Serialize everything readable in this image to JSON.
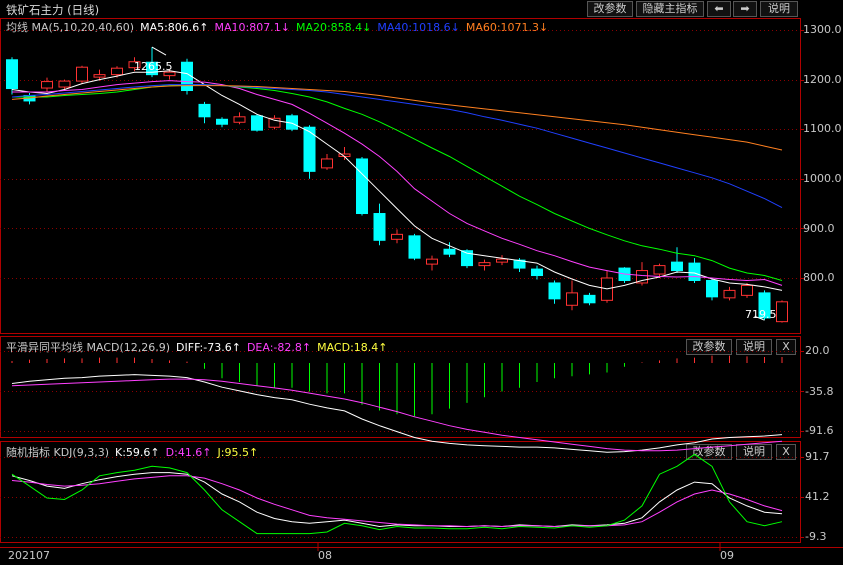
{
  "window": {
    "title": "铁矿石主力 (日线)",
    "buttons": {
      "modify": "改参数",
      "hide": "隐藏主指标",
      "left": "⬅",
      "right": "➡",
      "help": "说明"
    }
  },
  "colors": {
    "up": "#ff3232",
    "down": "#00ffff",
    "ma5": "#ffffff",
    "ma10": "#ff40ff",
    "ma20": "#00ff00",
    "ma40": "#2040ff",
    "ma60": "#ff8020",
    "grid": "#8b0000",
    "axis": "#b00000"
  },
  "main_panel": {
    "legend": {
      "name": "均线 MA(5,10,20,40,60)",
      "ma5": "MA5:806.6↑",
      "ma10": "MA10:807.1↓",
      "ma20": "MA20:858.4↓",
      "ma40": "MA40:1018.6↓",
      "ma60": "MA60:1071.3↓"
    },
    "high_label": "1265.5",
    "low_label": "719.5",
    "y_ticks": [
      "1300.0",
      "1200.0",
      "1100.0",
      "1000.0",
      "900.0",
      "800.0"
    ]
  },
  "macd_panel": {
    "legend": {
      "name": "平滑异同平均线 MACD(12,26,9)",
      "diff": "DIFF:-73.6↑",
      "dea": "DEA:-82.8↑",
      "macd": "MACD:18.4↑"
    },
    "buttons": {
      "modify": "改参数",
      "help": "说明",
      "close": "X"
    },
    "y_ticks": [
      "20.0",
      "-35.8",
      "-91.6"
    ]
  },
  "kdj_panel": {
    "legend": {
      "name": "随机指标 KDJ(9,3,3)",
      "k": "K:59.6↑",
      "d": "D:41.6↑",
      "j": "J:95.5↑"
    },
    "buttons": {
      "modify": "改参数",
      "help": "说明",
      "close": "X"
    },
    "y_ticks": [
      "91.7",
      "41.2",
      "-9.3"
    ]
  },
  "x_axis": {
    "labels": [
      "202107",
      "08",
      "09"
    ]
  },
  "chart_data": [
    {
      "type": "candlestick",
      "title": "铁矿石主力 (日线)",
      "ylim": [
        705,
        1325
      ],
      "candles": [
        {
          "o": 1240,
          "c": 1182,
          "h": 1245,
          "l": 1170
        },
        {
          "o": 1168,
          "c": 1157,
          "h": 1173,
          "l": 1150
        },
        {
          "o": 1183,
          "c": 1196,
          "h": 1204,
          "l": 1176
        },
        {
          "o": 1185,
          "c": 1197,
          "h": 1200,
          "l": 1180
        },
        {
          "o": 1197,
          "c": 1225,
          "h": 1228,
          "l": 1192
        },
        {
          "o": 1205,
          "c": 1210,
          "h": 1220,
          "l": 1198
        },
        {
          "o": 1210,
          "c": 1223,
          "h": 1227,
          "l": 1204
        },
        {
          "o": 1224,
          "c": 1236,
          "h": 1245,
          "l": 1217
        },
        {
          "o": 1235,
          "c": 1210,
          "h": 1265.5,
          "l": 1205
        },
        {
          "o": 1208,
          "c": 1215,
          "h": 1220,
          "l": 1200
        },
        {
          "o": 1235,
          "c": 1178,
          "h": 1242,
          "l": 1170
        },
        {
          "o": 1150,
          "c": 1125,
          "h": 1155,
          "l": 1112
        },
        {
          "o": 1120,
          "c": 1110,
          "h": 1124,
          "l": 1104
        },
        {
          "o": 1114,
          "c": 1125,
          "h": 1134,
          "l": 1110
        },
        {
          "o": 1127,
          "c": 1098,
          "h": 1130,
          "l": 1095
        },
        {
          "o": 1104,
          "c": 1122,
          "h": 1128,
          "l": 1100
        },
        {
          "o": 1127,
          "c": 1100,
          "h": 1131,
          "l": 1096
        },
        {
          "o": 1104,
          "c": 1015,
          "h": 1108,
          "l": 1000
        },
        {
          "o": 1022,
          "c": 1040,
          "h": 1050,
          "l": 1018
        },
        {
          "o": 1045,
          "c": 1050,
          "h": 1064,
          "l": 1038
        },
        {
          "o": 1040,
          "c": 930,
          "h": 1044,
          "l": 926
        },
        {
          "o": 930,
          "c": 876,
          "h": 950,
          "l": 866
        },
        {
          "o": 878,
          "c": 888,
          "h": 898,
          "l": 870
        },
        {
          "o": 885,
          "c": 840,
          "h": 889,
          "l": 836
        },
        {
          "o": 828,
          "c": 838,
          "h": 845,
          "l": 815
        },
        {
          "o": 858,
          "c": 848,
          "h": 872,
          "l": 842
        },
        {
          "o": 855,
          "c": 825,
          "h": 858,
          "l": 820
        },
        {
          "o": 825,
          "c": 831,
          "h": 837,
          "l": 815
        },
        {
          "o": 832,
          "c": 838,
          "h": 846,
          "l": 826
        },
        {
          "o": 836,
          "c": 820,
          "h": 840,
          "l": 812
        },
        {
          "o": 818,
          "c": 805,
          "h": 825,
          "l": 797
        },
        {
          "o": 790,
          "c": 758,
          "h": 795,
          "l": 748
        },
        {
          "o": 745,
          "c": 770,
          "h": 795,
          "l": 735
        },
        {
          "o": 765,
          "c": 750,
          "h": 770,
          "l": 745
        },
        {
          "o": 755,
          "c": 800,
          "h": 815,
          "l": 750
        },
        {
          "o": 820,
          "c": 795,
          "h": 822,
          "l": 790
        },
        {
          "o": 790,
          "c": 815,
          "h": 832,
          "l": 785
        },
        {
          "o": 808,
          "c": 825,
          "h": 829,
          "l": 800
        },
        {
          "o": 832,
          "c": 815,
          "h": 862,
          "l": 810
        },
        {
          "o": 830,
          "c": 795,
          "h": 840,
          "l": 790
        },
        {
          "o": 795,
          "c": 762,
          "h": 798,
          "l": 755
        },
        {
          "o": 760,
          "c": 775,
          "h": 782,
          "l": 755
        },
        {
          "o": 765,
          "c": 785,
          "h": 790,
          "l": 760
        },
        {
          "o": 770,
          "c": 719.5,
          "h": 775,
          "l": 715
        },
        {
          "o": 712,
          "c": 752,
          "h": 755,
          "l": 710
        }
      ],
      "series": [
        {
          "name": "MA5",
          "values": [
            1180,
            1175,
            1172,
            1180,
            1192,
            1200,
            1207,
            1215,
            1215,
            1218,
            1212,
            1190,
            1168,
            1150,
            1130,
            1118,
            1112,
            1095,
            1070,
            1045,
            1010,
            975,
            940,
            905,
            880,
            865,
            850,
            845,
            840,
            835,
            830,
            812,
            798,
            785,
            778,
            785,
            795,
            802,
            812,
            810,
            798,
            790,
            787,
            782,
            775
          ]
        },
        {
          "name": "MA10",
          "values": [
            1175,
            1175,
            1175,
            1178,
            1180,
            1185,
            1190,
            1193,
            1196,
            1198,
            1196,
            1195,
            1190,
            1182,
            1170,
            1160,
            1150,
            1132,
            1112,
            1092,
            1070,
            1045,
            1015,
            980,
            955,
            930,
            910,
            895,
            880,
            868,
            855,
            845,
            833,
            822,
            815,
            808,
            805,
            803,
            802,
            803,
            800,
            797,
            795,
            797,
            785
          ]
        },
        {
          "name": "MA20",
          "values": [
            1165,
            1165,
            1165,
            1168,
            1170,
            1172,
            1175,
            1180,
            1185,
            1188,
            1190,
            1190,
            1188,
            1185,
            1182,
            1178,
            1172,
            1165,
            1155,
            1142,
            1130,
            1115,
            1098,
            1080,
            1062,
            1045,
            1025,
            1005,
            985,
            965,
            948,
            930,
            915,
            900,
            887,
            875,
            865,
            858,
            850,
            845,
            835,
            820,
            810,
            805,
            795
          ]
        },
        {
          "name": "MA40",
          "values": [
            1165,
            1168,
            1170,
            1173,
            1176,
            1179,
            1182,
            1185,
            1188,
            1190,
            1190,
            1190,
            1188,
            1186,
            1184,
            1182,
            1180,
            1178,
            1175,
            1170,
            1165,
            1160,
            1155,
            1150,
            1145,
            1140,
            1133,
            1125,
            1118,
            1110,
            1102,
            1092,
            1082,
            1072,
            1062,
            1052,
            1042,
            1032,
            1022,
            1012,
            1002,
            990,
            975,
            960,
            942
          ]
        },
        {
          "name": "MA60",
          "values": [
            1160,
            1163,
            1167,
            1170,
            1173,
            1176,
            1179,
            1182,
            1185,
            1187,
            1188,
            1188,
            1188,
            1187,
            1186,
            1184,
            1182,
            1180,
            1178,
            1176,
            1172,
            1168,
            1163,
            1158,
            1153,
            1149,
            1145,
            1141,
            1137,
            1133,
            1129,
            1125,
            1121,
            1117,
            1113,
            1109,
            1104,
            1099,
            1094,
            1089,
            1084,
            1079,
            1074,
            1066,
            1058
          ]
        }
      ]
    },
    {
      "type": "line",
      "title": "MACD(12,26,9)",
      "ylim": [
        -98,
        27
      ],
      "series": [
        {
          "name": "DIFF",
          "values": [
            -5,
            -2,
            0,
            2,
            3,
            5,
            6,
            7,
            6,
            5,
            3,
            -3,
            -10,
            -15,
            -20,
            -24,
            -27,
            -33,
            -38,
            -42,
            -53,
            -62,
            -70,
            -78,
            -83,
            -86,
            -88,
            -89,
            -90,
            -91,
            -91,
            -92,
            -94,
            -96,
            -98,
            -97,
            -95,
            -92,
            -88,
            -85,
            -80,
            -78,
            -77,
            -76,
            -74
          ]
        },
        {
          "name": "DEA",
          "values": [
            -8,
            -7,
            -6,
            -5,
            -4,
            -3,
            -2,
            -1,
            0,
            1,
            1,
            0,
            -2,
            -5,
            -8,
            -11,
            -14,
            -18,
            -22,
            -26,
            -31,
            -37,
            -43,
            -50,
            -56,
            -62,
            -67,
            -71,
            -75,
            -78,
            -81,
            -84,
            -87,
            -90,
            -93,
            -95,
            -96,
            -96,
            -95,
            -93,
            -91,
            -89,
            -87,
            -85,
            -83
          ]
        },
        {
          "name": "MACD",
          "values": [
            6,
            10,
            12,
            14,
            14,
            16,
            16,
            16,
            12,
            8,
            4,
            -6,
            -16,
            -20,
            -24,
            -26,
            -26,
            -30,
            -32,
            -32,
            -44,
            -50,
            -54,
            -56,
            -54,
            -48,
            -42,
            -36,
            -30,
            -26,
            -20,
            -16,
            -14,
            -12,
            -10,
            -4,
            2,
            8,
            14,
            16,
            22,
            22,
            20,
            18,
            18
          ]
        }
      ]
    },
    {
      "type": "line",
      "title": "KDJ(9,3,3)",
      "ylim": [
        -15,
        98
      ],
      "series": [
        {
          "name": "K",
          "values": [
            68,
            62,
            55,
            52,
            58,
            63,
            67,
            70,
            72,
            72,
            70,
            60,
            45,
            35,
            22,
            14,
            10,
            8,
            10,
            12,
            8,
            4,
            6,
            5,
            5,
            4,
            4,
            5,
            4,
            6,
            5,
            4,
            6,
            5,
            6,
            8,
            15,
            35,
            50,
            60,
            58,
            40,
            30,
            22,
            20
          ]
        },
        {
          "name": "D",
          "values": [
            62,
            60,
            57,
            55,
            56,
            58,
            61,
            64,
            66,
            68,
            68,
            65,
            58,
            50,
            40,
            32,
            25,
            18,
            15,
            13,
            11,
            9,
            7,
            6,
            5,
            5,
            4,
            5,
            4,
            5,
            5,
            4,
            5,
            5,
            5,
            6,
            10,
            22,
            35,
            45,
            50,
            45,
            38,
            30,
            24
          ]
        },
        {
          "name": "J",
          "values": [
            70,
            55,
            40,
            38,
            50,
            68,
            72,
            75,
            80,
            78,
            72,
            50,
            25,
            10,
            -5,
            -5,
            -5,
            -5,
            -3,
            8,
            5,
            0,
            4,
            2,
            2,
            1,
            1,
            3,
            1,
            4,
            3,
            2,
            5,
            3,
            5,
            12,
            30,
            70,
            80,
            95,
            80,
            35,
            10,
            5,
            10
          ]
        }
      ]
    }
  ]
}
